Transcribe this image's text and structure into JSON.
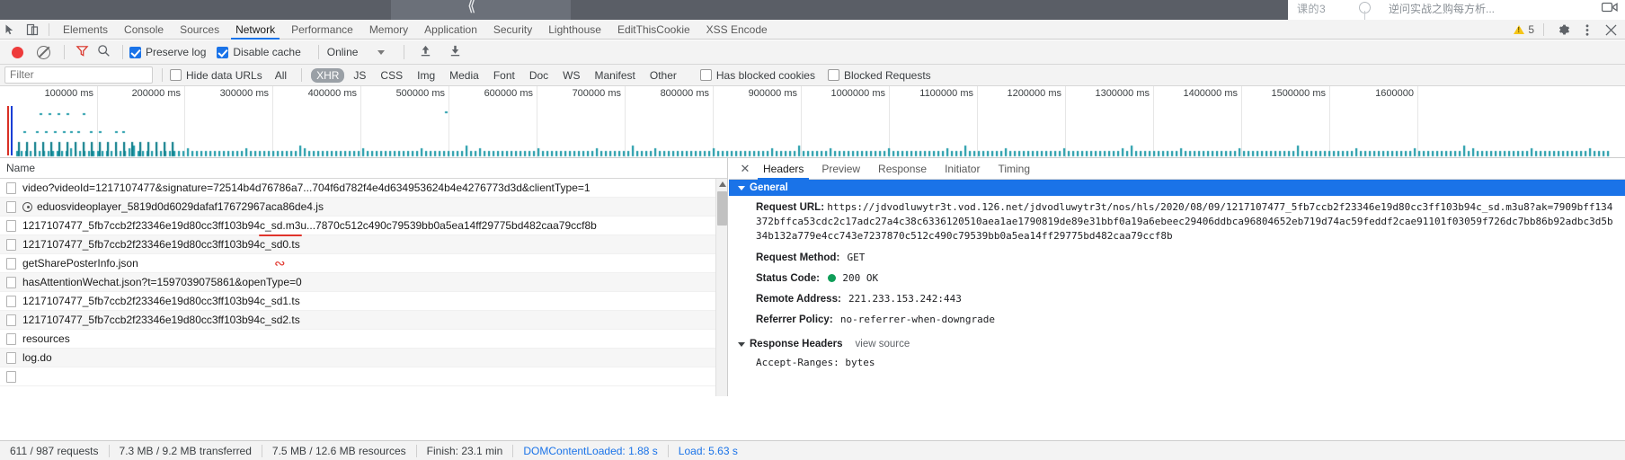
{
  "page_strip": {
    "right_label": "课的3",
    "right_title": "逆问实战之购每方析...",
    "camera_icon": "camera-icon"
  },
  "tabbar": {
    "icons": [
      "inspect-element-icon",
      "device-toolbar-icon"
    ],
    "tabs": [
      {
        "label": "Elements",
        "active": false
      },
      {
        "label": "Console",
        "active": false
      },
      {
        "label": "Sources",
        "active": false
      },
      {
        "label": "Network",
        "active": true
      },
      {
        "label": "Performance",
        "active": false
      },
      {
        "label": "Memory",
        "active": false
      },
      {
        "label": "Application",
        "active": false
      },
      {
        "label": "Security",
        "active": false
      },
      {
        "label": "Lighthouse",
        "active": false
      },
      {
        "label": "EditThisCookie",
        "active": false
      },
      {
        "label": "XSS Encode",
        "active": false
      }
    ],
    "warning_count": "5",
    "warning_icon": "warning-triangle-icon",
    "settings_icon": "gear-icon",
    "more_icon": "kebab-menu-icon",
    "close_icon": "close-icon"
  },
  "toolbar": {
    "record_icon": "record-button",
    "clear_icon": "clear-icon",
    "filter_icon": "funnel-icon",
    "search_icon": "search-icon",
    "preserve_log_label": "Preserve log",
    "preserve_log_checked": true,
    "disable_cache_label": "Disable cache",
    "disable_cache_checked": true,
    "throttle_value": "Online",
    "import_icon": "import-har-icon",
    "export_icon": "export-har-icon"
  },
  "filterbar": {
    "filter_placeholder": "Filter",
    "filter_value": "",
    "hide_data_urls_label": "Hide data URLs",
    "hide_data_urls_checked": false,
    "types": [
      {
        "label": "All",
        "selected": false
      },
      {
        "label": "XHR",
        "selected": true
      },
      {
        "label": "JS",
        "selected": false
      },
      {
        "label": "CSS",
        "selected": false
      },
      {
        "label": "Img",
        "selected": false
      },
      {
        "label": "Media",
        "selected": false
      },
      {
        "label": "Font",
        "selected": false
      },
      {
        "label": "Doc",
        "selected": false
      },
      {
        "label": "WS",
        "selected": false
      },
      {
        "label": "Manifest",
        "selected": false
      },
      {
        "label": "Other",
        "selected": false
      }
    ],
    "has_blocked_cookies_label": "Has blocked cookies",
    "has_blocked_cookies_checked": false,
    "blocked_requests_label": "Blocked Requests",
    "blocked_requests_checked": false
  },
  "overview": {
    "ticks": [
      "100000 ms",
      "200000 ms",
      "300000 ms",
      "400000 ms",
      "500000 ms",
      "600000 ms",
      "700000 ms",
      "800000 ms",
      "900000 ms",
      "1000000 ms",
      "1100000 ms",
      "1200000 ms",
      "1300000 ms",
      "1400000 ms",
      "1500000 ms",
      "1600000"
    ]
  },
  "requests": {
    "column_header": "Name",
    "rows": [
      {
        "name": "video?videoId=1217107477&signature=72514b4d76786a7...704f6d782f4e4d634953624b4e4276773d3d&clientType=1",
        "has_icon": false
      },
      {
        "name": "eduosvideoplayer_5819d0d6029dafaf17672967aca86de4.js",
        "has_icon": true
      },
      {
        "name": "1217107477_5fb7ccb2f23346e19d80cc3ff103b94c_sd.m3u...7870c512c490c79539bb0a5ea14ff29775bd482caa79ccf8b",
        "has_icon": false
      },
      {
        "name": "1217107477_5fb7ccb2f23346e19d80cc3ff103b94c_sd0.ts",
        "has_icon": false
      },
      {
        "name": "getSharePosterInfo.json",
        "has_icon": false
      },
      {
        "name": "hasAttentionWechat.json?t=1597039075861&openType=0",
        "has_icon": false
      },
      {
        "name": "1217107477_5fb7ccb2f23346e19d80cc3ff103b94c_sd1.ts",
        "has_icon": false
      },
      {
        "name": "1217107477_5fb7ccb2f23346e19d80cc3ff103b94c_sd2.ts",
        "has_icon": false
      },
      {
        "name": "resources",
        "has_icon": false
      },
      {
        "name": "log.do",
        "has_icon": false
      }
    ]
  },
  "details": {
    "close_icon": "close-icon",
    "tabs": [
      {
        "label": "Headers",
        "active": true
      },
      {
        "label": "Preview",
        "active": false
      },
      {
        "label": "Response",
        "active": false
      },
      {
        "label": "Initiator",
        "active": false
      },
      {
        "label": "Timing",
        "active": false
      }
    ],
    "general_section": "General",
    "request_url_label": "Request URL:",
    "request_url_value": "https://jdvodluwytr3t.vod.126.net/jdvodluwytr3t/nos/hls/2020/08/09/1217107477_5fb7ccb2f23346e19d80cc3ff103b94c_sd.m3u8?ak=7909bff134372bffca53cdc2c17adc27a4c38c6336120510aea1ae1790819de89e31bbf0a19a6ebeec29406ddbca96804652eb719d74ac59feddf2cae91101f03059f726dc7bb86b92adbc3d5b34b132a779e4cc743e7237870c512c490c79539bb0a5ea14ff29775bd482caa79ccf8b",
    "request_method_label": "Request Method:",
    "request_method_value": "GET",
    "status_code_label": "Status Code:",
    "status_code_value": "200 OK",
    "status_icon": "green-status-dot",
    "remote_address_label": "Remote Address:",
    "remote_address_value": "221.233.153.242:443",
    "referrer_policy_label": "Referrer Policy:",
    "referrer_policy_value": "no-referrer-when-downgrade",
    "response_headers_section": "Response Headers",
    "view_source_label": "view source",
    "response_first_header": "Accept-Ranges: bytes"
  },
  "status": {
    "requests": "611 / 987 requests",
    "transferred": "7.3 MB / 9.2 MB transferred",
    "resources": "7.5 MB / 12.6 MB resources",
    "finish": "Finish: 23.1 min",
    "dcl": "DOMContentLoaded: 1.88 s",
    "load": "Load: 5.63 s"
  },
  "colors": {
    "accent": "#1a73e8",
    "record": "#ee3b3b",
    "annotation_red": "#e0342b",
    "status_ok": "#0f9d58"
  }
}
